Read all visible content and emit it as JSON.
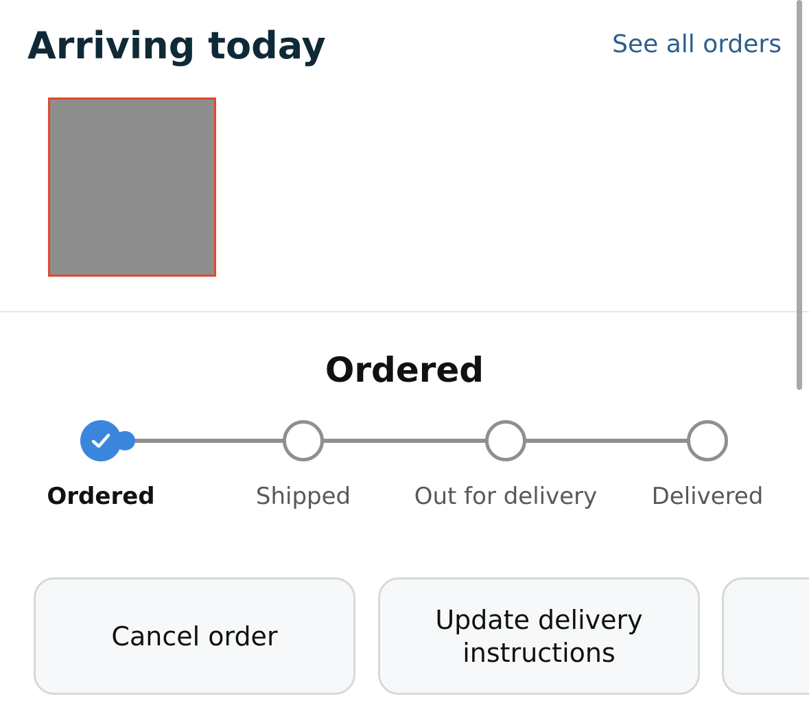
{
  "header": {
    "title": "Arriving today",
    "see_all_link": "See all orders"
  },
  "status": {
    "current": "Ordered"
  },
  "tracker": {
    "steps": [
      {
        "label": "Ordered",
        "state": "complete"
      },
      {
        "label": "Shipped",
        "state": "pending"
      },
      {
        "label": "Out for delivery",
        "state": "pending"
      },
      {
        "label": "Delivered",
        "state": "pending"
      }
    ]
  },
  "actions": [
    {
      "label": "Cancel order"
    },
    {
      "label": "Update delivery instructions"
    },
    {
      "label": ""
    }
  ],
  "colors": {
    "accent": "#3a86dd",
    "link": "#2e5f8a",
    "title": "#0f2a36",
    "image_border": "#e0492c"
  }
}
